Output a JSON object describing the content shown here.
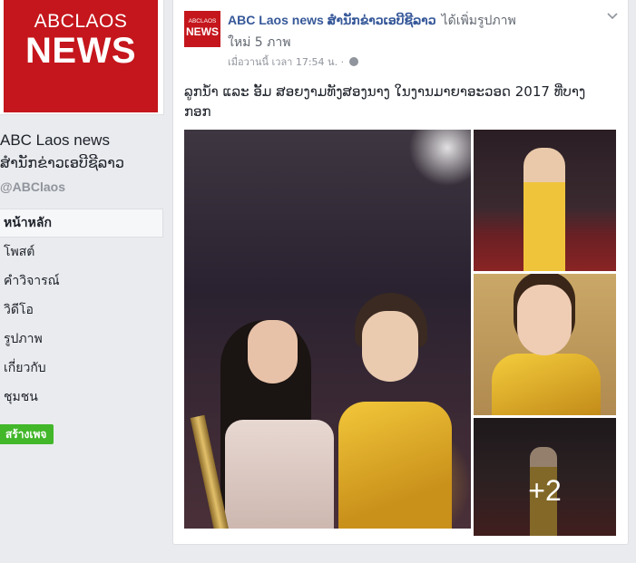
{
  "sidebar": {
    "logo_line1": "ABCLAOS",
    "logo_line2": "NEWS",
    "page_name": "ABC Laos news",
    "page_name_lao": "ສຳນັກຂ່າວເອບີຊີລາວ",
    "handle": "@ABClaos",
    "nav": [
      {
        "label": "หน้าหลัก",
        "active": true
      },
      {
        "label": "โพสต์"
      },
      {
        "label": "คำวิจารณ์"
      },
      {
        "label": "วิดีโอ"
      },
      {
        "label": "รูปภาพ"
      },
      {
        "label": "เกี่ยวกับ"
      },
      {
        "label": "ชุมชน"
      }
    ],
    "create_page_label": "สร้างเพจ"
  },
  "post": {
    "avatar_line1": "ABCLAOS",
    "avatar_line2": "NEWS",
    "author": "ABC Laos news ສຳນັກຂ່າວເອບີຊີລາວ",
    "action": "ได้เพิ่มรูปภาพ",
    "sub_action": "ใหม่ 5 ภาพ",
    "timestamp": "เมื่อวานนี้ เวลา 17:54 น. ·",
    "text": "ລູກນ້ຳ ແລະ ອັ້ມ ສອຍງາມທັງສອງນາງ ໃນງານມາຍາອະວອດ 2017 ທີ່ບາງກອກ",
    "more_photos": "+2",
    "icons": {
      "privacy": "globe-icon",
      "menu": "chevron-down-icon"
    }
  }
}
